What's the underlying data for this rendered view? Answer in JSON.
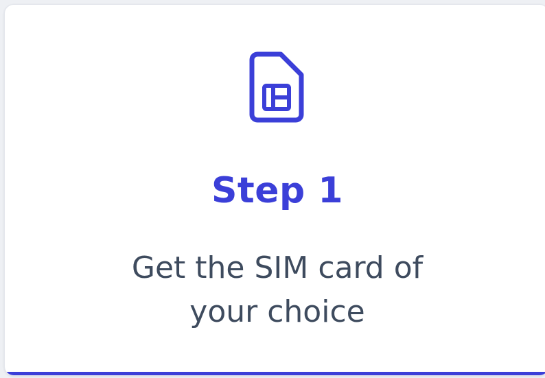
{
  "card": {
    "icon": "sim-card-icon",
    "title": "Step 1",
    "description": "Get the SIM card of your choice"
  },
  "colors": {
    "accent": "#3b3fd8",
    "text": "#3e4b5e",
    "background": "#ffffff"
  }
}
